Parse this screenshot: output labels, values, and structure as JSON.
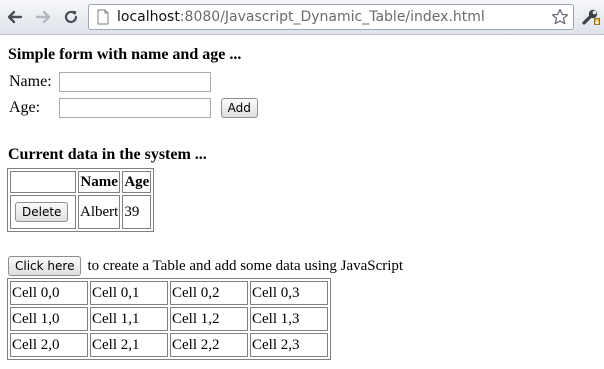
{
  "browser": {
    "url_host": "localhost",
    "url_rest": ":8080/Javascript_Dynamic_Table/index.html",
    "icons": {
      "back": "back-arrow-icon",
      "forward": "forward-arrow-icon",
      "reload": "reload-icon",
      "page": "page-icon",
      "star": "star-icon",
      "wrench": "wrench-icon"
    }
  },
  "form": {
    "title": "Simple form with name and age ...",
    "name_label": "Name:",
    "age_label": "Age:",
    "name_value": "",
    "age_value": "",
    "add_label": "Add"
  },
  "data_section": {
    "title": "Current data in the system ...",
    "headers": [
      "",
      "Name",
      "Age"
    ],
    "rows": [
      {
        "action": "Delete",
        "name": "Albert",
        "age": "39"
      }
    ]
  },
  "table_section": {
    "button_label": "Click here",
    "description": "to create a Table and add some data using JavaScript",
    "cells": [
      [
        "Cell 0,0",
        "Cell 0,1",
        "Cell 0,2",
        "Cell 0,3"
      ],
      [
        "Cell 1,0",
        "Cell 1,1",
        "Cell 1,2",
        "Cell 1,3"
      ],
      [
        "Cell 2,0",
        "Cell 2,1",
        "Cell 2,2",
        "Cell 2,3"
      ]
    ]
  }
}
